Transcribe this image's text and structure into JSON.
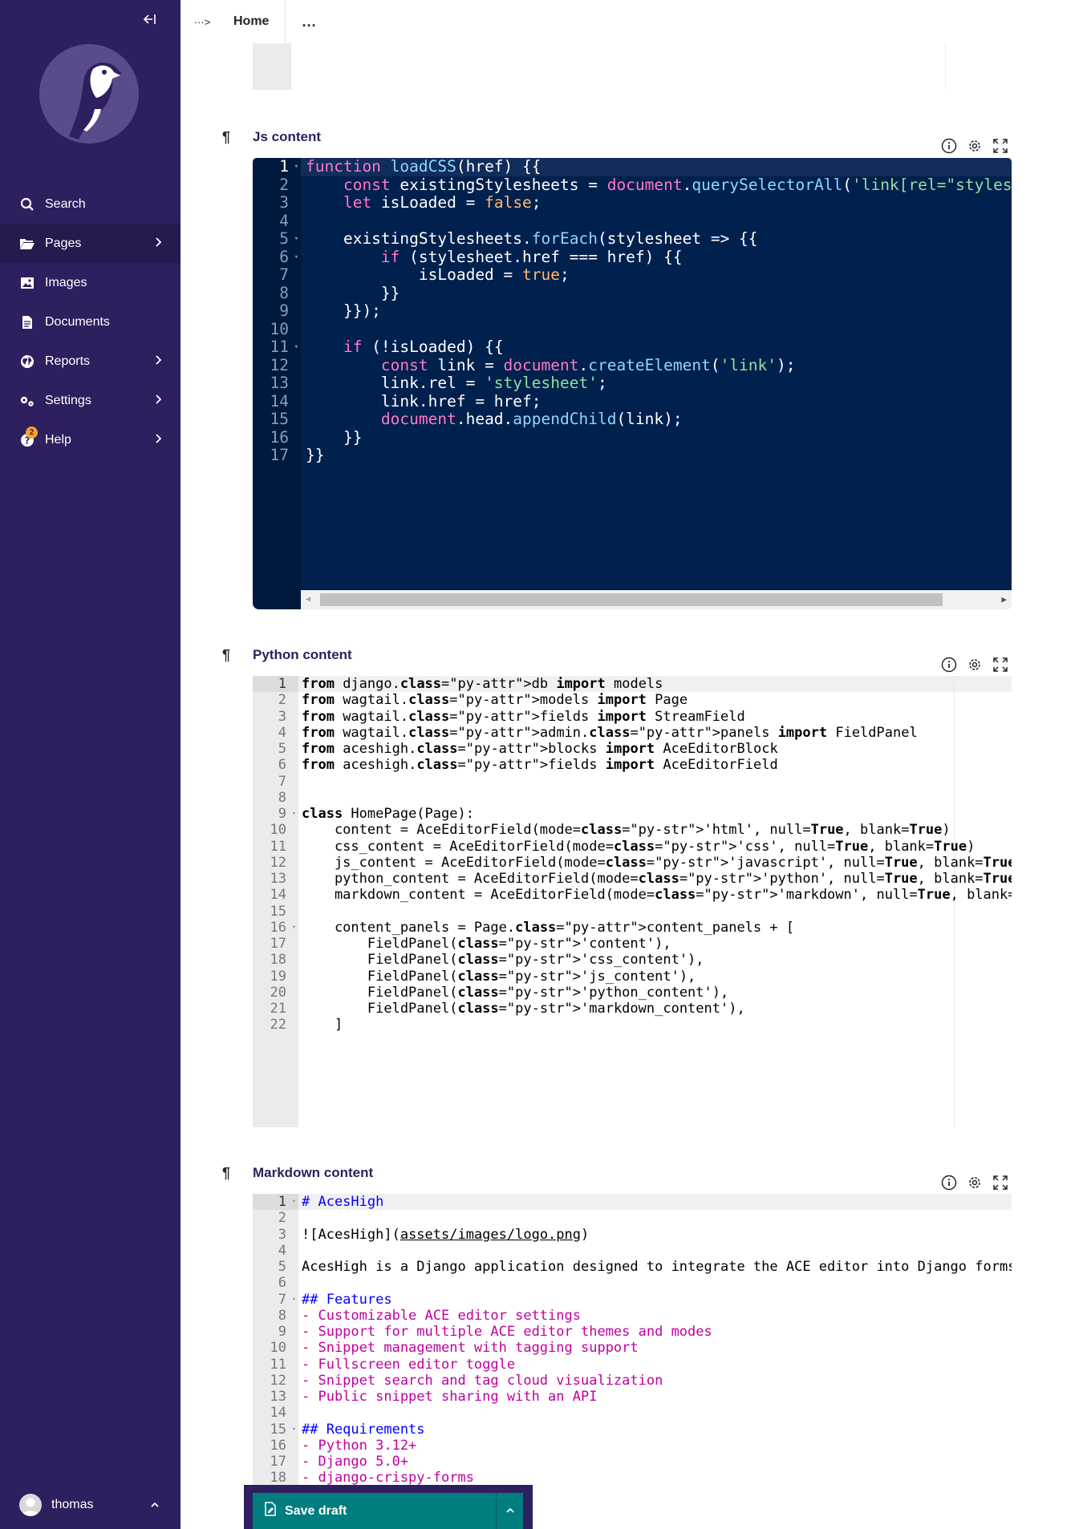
{
  "sidebar": {
    "collapse_icon": "collapse-left-icon",
    "logo": "wagtail-bird-logo",
    "items": [
      {
        "label": "Search",
        "icon": "search-icon"
      },
      {
        "label": "Pages",
        "icon": "folder-icon",
        "has_submenu": true,
        "active": true
      },
      {
        "label": "Images",
        "icon": "image-icon"
      },
      {
        "label": "Documents",
        "icon": "document-icon"
      },
      {
        "label": "Reports",
        "icon": "globe-icon",
        "has_submenu": true
      },
      {
        "label": "Settings",
        "icon": "cogs-icon",
        "has_submenu": true
      },
      {
        "label": "Help",
        "icon": "help-icon",
        "has_submenu": true,
        "badge": "2"
      }
    ],
    "account": {
      "name": "thomas"
    }
  },
  "breadcrumb": {
    "toggle": "···>",
    "home": "Home",
    "more": "..."
  },
  "fields": [
    {
      "label": "Js content",
      "theme": "dark",
      "lines": [
        "function loadCSS(href) {{",
        "    const existingStylesheets = document.querySelectorAll('link[rel=\"stylesheet",
        "    let isLoaded = false;",
        "",
        "    existingStylesheets.forEach(stylesheet => {{",
        "        if (stylesheet.href === href) {{",
        "            isLoaded = true;",
        "        }}",
        "    }});",
        "",
        "    if (!isLoaded) {{",
        "        const link = document.createElement('link');",
        "        link.rel = 'stylesheet';",
        "        link.href = href;",
        "        document.head.appendChild(link);",
        "    }}",
        "}}"
      ]
    },
    {
      "label": "Python content",
      "theme": "light",
      "lines": [
        "from django.db import models",
        "from wagtail.models import Page",
        "from wagtail.fields import StreamField",
        "from wagtail.admin.panels import FieldPanel",
        "from aceshigh.blocks import AceEditorBlock",
        "from aceshigh.fields import AceEditorField",
        "",
        "",
        "class HomePage(Page):",
        "    content = AceEditorField(mode='html', null=True, blank=True)",
        "    css_content = AceEditorField(mode='css', null=True, blank=True)",
        "    js_content = AceEditorField(mode='javascript', null=True, blank=True)",
        "    python_content = AceEditorField(mode='python', null=True, blank=True)",
        "    markdown_content = AceEditorField(mode='markdown', null=True, blank=True)",
        "",
        "    content_panels = Page.content_panels + [",
        "        FieldPanel('content'),",
        "        FieldPanel('css_content'),",
        "        FieldPanel('js_content'),",
        "        FieldPanel('python_content'),",
        "        FieldPanel('markdown_content'),",
        "    ]"
      ]
    },
    {
      "label": "Markdown content",
      "theme": "light",
      "lines": [
        "# AcesHigh",
        "",
        "![AcesHigh](assets/images/logo.png)",
        "",
        "AcesHigh is a Django application designed to integrate the ACE editor into Django forms",
        "",
        "## Features",
        "- Customizable ACE editor settings",
        "- Support for multiple ACE editor themes and modes",
        "- Snippet management with tagging support",
        "- Fullscreen editor toggle",
        "- Snippet search and tag cloud visualization",
        "- Public snippet sharing with an API",
        "",
        "## Requirements",
        "- Python 3.12+",
        "- Django 5.0+",
        "- django-crispy-forms"
      ]
    }
  ],
  "footer": {
    "save_label": "Save draft"
  }
}
